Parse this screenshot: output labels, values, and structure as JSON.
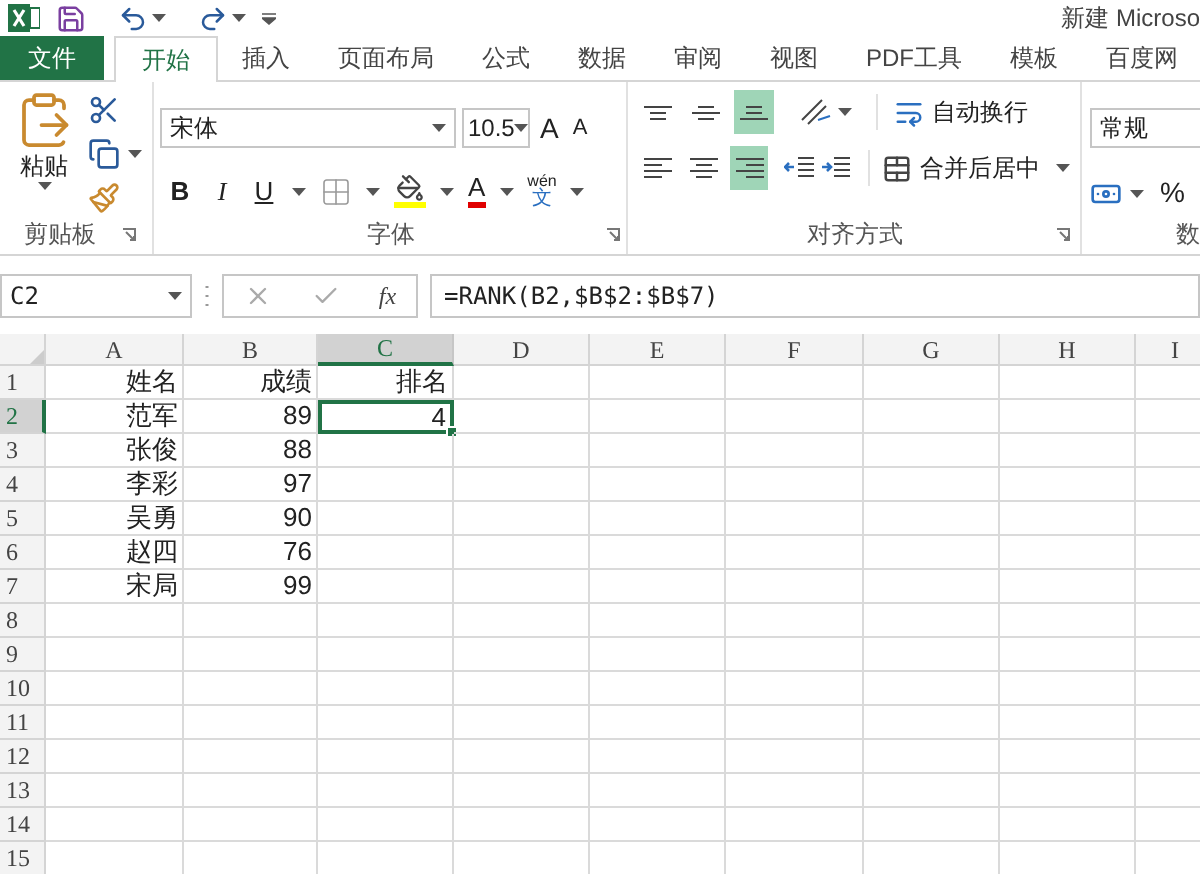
{
  "title_bar": {
    "title": "新建 Microso"
  },
  "tabs": [
    {
      "label": "文件",
      "kind": "file",
      "selected": false
    },
    {
      "label": "开始",
      "kind": "tab",
      "selected": true
    },
    {
      "label": "插入",
      "kind": "tab",
      "selected": false
    },
    {
      "label": "页面布局",
      "kind": "tab",
      "selected": false
    },
    {
      "label": "公式",
      "kind": "tab",
      "selected": false
    },
    {
      "label": "数据",
      "kind": "tab",
      "selected": false
    },
    {
      "label": "审阅",
      "kind": "tab",
      "selected": false
    },
    {
      "label": "视图",
      "kind": "tab",
      "selected": false
    },
    {
      "label": "PDF工具",
      "kind": "tab",
      "selected": false
    },
    {
      "label": "模板",
      "kind": "tab",
      "selected": false
    },
    {
      "label": "百度网",
      "kind": "tab",
      "selected": false
    }
  ],
  "ribbon": {
    "clipboard": {
      "label": "剪贴板",
      "paste": "粘贴"
    },
    "font": {
      "label": "字体",
      "font_name": "宋体",
      "font_size": "10.5",
      "grow": "A",
      "shrink": "A",
      "bold": "B",
      "italic": "I",
      "underline": "U",
      "font_color": "A",
      "phonetic_top": "wén",
      "phonetic_bottom": "文"
    },
    "alignment": {
      "label": "对齐方式",
      "vertical": [
        {
          "kind": "top",
          "selected": false
        },
        {
          "kind": "middle",
          "selected": false
        },
        {
          "kind": "bottom",
          "selected": true
        }
      ],
      "horizontal": [
        {
          "kind": "left",
          "selected": false
        },
        {
          "kind": "center",
          "selected": false
        },
        {
          "kind": "right",
          "selected": true
        }
      ],
      "wrap": "自动换行",
      "merge": "合并后居中"
    },
    "number": {
      "label": "数",
      "format": "常规",
      "percent": "%"
    }
  },
  "formula_bar": {
    "name_box": "C2",
    "fx": "fx",
    "formula": "=RANK(B2,$B$2:$B$7)"
  },
  "sheet": {
    "columns": [
      {
        "label": "A",
        "selected": false
      },
      {
        "label": "B",
        "selected": false
      },
      {
        "label": "C",
        "selected": true
      },
      {
        "label": "D",
        "selected": false
      },
      {
        "label": "E",
        "selected": false
      },
      {
        "label": "F",
        "selected": false
      },
      {
        "label": "G",
        "selected": false
      },
      {
        "label": "H",
        "selected": false
      },
      {
        "label": "I",
        "selected": false
      }
    ],
    "rows": [
      {
        "label": "1",
        "selected": false,
        "cells": [
          {
            "text": "姓名",
            "selected": false
          },
          {
            "text": "成绩",
            "selected": false
          },
          {
            "text": "排名",
            "selected": false
          }
        ]
      },
      {
        "label": "2",
        "selected": true,
        "cells": [
          {
            "text": "范军",
            "selected": false
          },
          {
            "text": "89",
            "selected": false
          },
          {
            "text": "4",
            "selected": true
          }
        ]
      },
      {
        "label": "3",
        "selected": false,
        "cells": [
          {
            "text": "张俊",
            "selected": false
          },
          {
            "text": "88",
            "selected": false
          }
        ]
      },
      {
        "label": "4",
        "selected": false,
        "cells": [
          {
            "text": "李彩",
            "selected": false
          },
          {
            "text": "97",
            "selected": false
          }
        ]
      },
      {
        "label": "5",
        "selected": false,
        "cells": [
          {
            "text": "吴勇",
            "selected": false
          },
          {
            "text": "90",
            "selected": false
          }
        ]
      },
      {
        "label": "6",
        "selected": false,
        "cells": [
          {
            "text": "赵四",
            "selected": false
          },
          {
            "text": "76",
            "selected": false
          }
        ]
      },
      {
        "label": "7",
        "selected": false,
        "cells": [
          {
            "text": "宋局",
            "selected": false
          },
          {
            "text": "99",
            "selected": false
          }
        ]
      },
      {
        "label": "8",
        "selected": false
      },
      {
        "label": "9",
        "selected": false
      },
      {
        "label": "10",
        "selected": false
      },
      {
        "label": "11",
        "selected": false
      },
      {
        "label": "12",
        "selected": false
      },
      {
        "label": "13",
        "selected": false
      },
      {
        "label": "14",
        "selected": false
      },
      {
        "label": "15",
        "selected": false
      }
    ]
  }
}
